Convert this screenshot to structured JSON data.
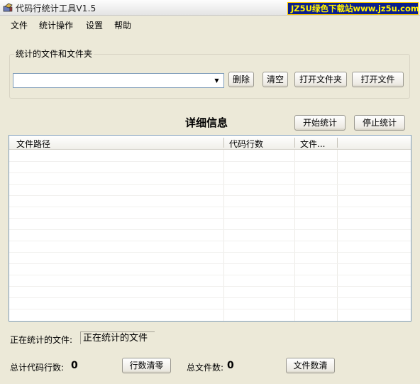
{
  "window": {
    "title": "代码行统计工具V1.5",
    "watermark": "JZ5U绿色下载站www.jz5u.com"
  },
  "menu": [
    "文件",
    "统计操作",
    "设置",
    "帮助"
  ],
  "file_selection": {
    "group_label": "统计的文件和文件夹",
    "path_value": "",
    "delete_label": "删除",
    "clear_label": "清空",
    "open_folder_label": "打开文件夹",
    "open_file_label": "打开文件"
  },
  "details": {
    "title": "详细信息",
    "start_label": "开始统计",
    "stop_label": "停止统计",
    "columns": [
      "文件路径",
      "代码行数",
      "文件..."
    ],
    "rows": []
  },
  "status": {
    "current_file_label": "正在统计的文件:",
    "current_file_value": "正在统计的文件",
    "total_lines_label": "总计代码行数:",
    "total_lines_value": "0",
    "reset_lines_label": "行数清零",
    "total_files_label": "总文件数:",
    "total_files_value": "0",
    "reset_files_label": "文件数清"
  },
  "colors": {
    "window_bg": "#ECE9D8",
    "watermark_bg": "#0a1e8c",
    "watermark_text": "#fff200"
  },
  "icons": [
    "app-icon",
    "combo-dropdown-arrow-icon"
  ]
}
